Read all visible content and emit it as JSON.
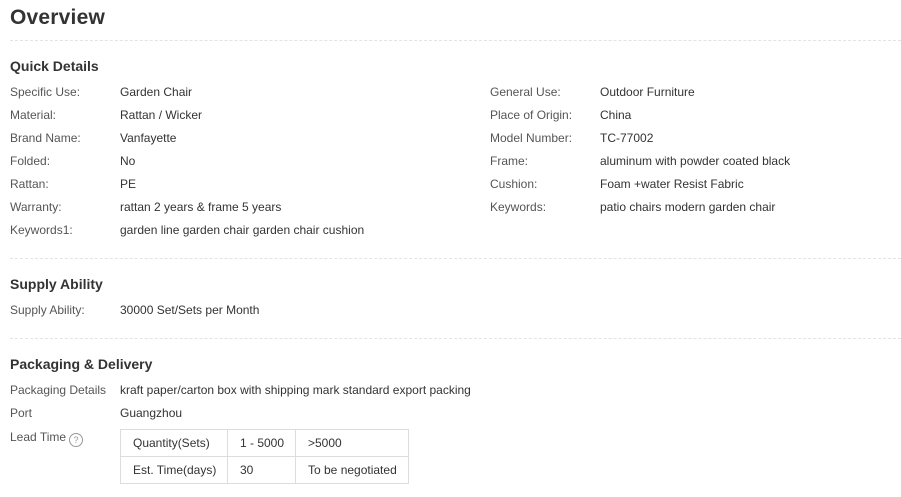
{
  "title": "Overview",
  "quick_details": {
    "heading": "Quick Details",
    "left": [
      {
        "label": "Specific Use:",
        "value": "Garden Chair"
      },
      {
        "label": "Material:",
        "value": "Rattan / Wicker"
      },
      {
        "label": "Brand Name:",
        "value": "Vanfayette"
      },
      {
        "label": "Folded:",
        "value": "No"
      },
      {
        "label": "Rattan:",
        "value": "PE"
      },
      {
        "label": "Warranty:",
        "value": "rattan 2 years & frame 5 years"
      },
      {
        "label": "Keywords1:",
        "value": "garden line garden chair garden chair cushion"
      }
    ],
    "right": [
      {
        "label": "General Use:",
        "value": "Outdoor Furniture"
      },
      {
        "label": "Place of Origin:",
        "value": "China"
      },
      {
        "label": "Model Number:",
        "value": "TC-77002"
      },
      {
        "label": "Frame:",
        "value": "aluminum with powder coated black"
      },
      {
        "label": "Cushion:",
        "value": "Foam +water Resist Fabric"
      },
      {
        "label": "Keywords:",
        "value": "patio chairs modern garden chair"
      }
    ]
  },
  "supply_ability": {
    "heading": "Supply Ability",
    "label": "Supply Ability:",
    "value": "30000 Set/Sets per Month"
  },
  "packaging": {
    "heading": "Packaging & Delivery",
    "details_label": "Packaging Details",
    "details_value": "kraft paper/carton box with shipping mark standard export packing",
    "port_label": "Port",
    "port_value": "Guangzhou",
    "lead_time_label": "Lead Time",
    "help_glyph": "?",
    "lead_table": [
      [
        "Quantity(Sets)",
        "1 - 5000",
        ">5000"
      ],
      [
        "Est. Time(days)",
        "30",
        "To be negotiated"
      ]
    ]
  }
}
